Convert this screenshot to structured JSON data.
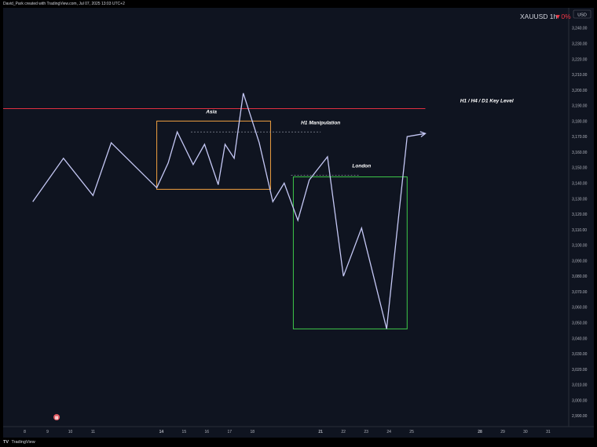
{
  "header": {
    "attribution": "David_Park created with TradingView.com, Jul 07, 2025 13:03 UTC+2"
  },
  "footer": {
    "logo_glyph": "TV",
    "brand": "TradingView"
  },
  "chart_data": {
    "type": "line",
    "symbol": "XAUUSD",
    "timeframe": "1h",
    "change": "▼0%",
    "currency": "USD",
    "x_ticks": [
      {
        "x": 8,
        "label": "8",
        "bold": false
      },
      {
        "x": 9,
        "label": "9",
        "bold": false
      },
      {
        "x": 10,
        "label": "10",
        "bold": false
      },
      {
        "x": 11,
        "label": "11",
        "bold": false
      },
      {
        "x": 14,
        "label": "14",
        "bold": true
      },
      {
        "x": 15,
        "label": "15",
        "bold": false
      },
      {
        "x": 16,
        "label": "16",
        "bold": false
      },
      {
        "x": 17,
        "label": "17",
        "bold": false
      },
      {
        "x": 18,
        "label": "18",
        "bold": false
      },
      {
        "x": 21,
        "label": "21",
        "bold": true
      },
      {
        "x": 22,
        "label": "22",
        "bold": false
      },
      {
        "x": 23,
        "label": "23",
        "bold": false
      },
      {
        "x": 24,
        "label": "24",
        "bold": false
      },
      {
        "x": 25,
        "label": "25",
        "bold": false
      },
      {
        "x": 28,
        "label": "28",
        "bold": true
      },
      {
        "x": 29,
        "label": "29",
        "bold": false
      },
      {
        "x": 30,
        "label": "30",
        "bold": false
      },
      {
        "x": 31,
        "label": "31",
        "bold": false
      }
    ],
    "y_ticks": [
      2990,
      3000,
      3010,
      3020,
      3030,
      3040,
      3050,
      3060,
      3070,
      3080,
      3090,
      3100,
      3110,
      3120,
      3130,
      3140,
      3150,
      3160,
      3170,
      3180,
      3190,
      3200,
      3210,
      3220,
      3230,
      3240
    ],
    "y_tick_labels": [
      "2,990.00",
      "3,000.00",
      "3,010.00",
      "3,020.00",
      "3,030.00",
      "3,040.00",
      "3,050.00",
      "3,060.00",
      "3,070.00",
      "3,080.00",
      "3,090.00",
      "3,100.00",
      "3,110.00",
      "3,120.00",
      "3,130.00",
      "3,140.00",
      "3,150.00",
      "3,160.00",
      "3,170.00",
      "3,180.00",
      "3,190.00",
      "3,200.00",
      "3,210.00",
      "3,220.00",
      "3,230.00",
      "3,240.00"
    ],
    "ylim": [
      2983,
      3253
    ],
    "xlim": [
      7.05,
      31.9
    ],
    "series": [
      {
        "color": "#c5c8f5",
        "x": [
          8.35,
          9.7,
          11.0,
          11.8,
          13.8,
          14.3,
          14.7,
          15.0,
          15.4,
          15.9,
          16.5,
          16.8,
          17.2,
          17.6,
          18.3,
          18.9,
          19.4,
          20.0,
          20.5,
          21.3,
          22.0,
          22.8,
          23.9,
          24.8,
          25.6
        ],
        "y": [
          3128,
          3156,
          3132,
          3166,
          3137,
          3153,
          3173,
          3164,
          3152,
          3165,
          3139,
          3165,
          3156,
          3198,
          3166,
          3128,
          3140,
          3116,
          3142,
          3157,
          3080,
          3111,
          3046,
          3170,
          3172
        ],
        "arrow_end": true
      }
    ],
    "annotations": [
      {
        "type": "hline",
        "y": 3188,
        "x0": 7.05,
        "x1": 25.6,
        "color": "#e03040",
        "label": "H1 / H4 / D1 Key  Level",
        "label_x": 28.3,
        "label_y": 3192
      },
      {
        "type": "rect",
        "x0": 13.8,
        "x1": 18.8,
        "y0": 3136,
        "y1": 3180,
        "color": "#f0a040",
        "label": "Asia",
        "label_x": 16.2,
        "label_y": 3185
      },
      {
        "type": "dashed_line",
        "x0": 15.3,
        "x1": 21.0,
        "y": 3173,
        "color": "#8a8f9c",
        "label": "H1  Manipulation",
        "label_x": 21.0,
        "label_y": 3178
      },
      {
        "type": "rect",
        "x0": 19.8,
        "x1": 24.8,
        "y0": 3046,
        "y1": 3144,
        "color": "#3ec94a",
        "label": "London",
        "label_x": 22.8,
        "label_y": 3150
      },
      {
        "type": "dashed_line",
        "x0": 19.7,
        "x1": 22.7,
        "y": 3145,
        "color": "#8a8f9c"
      }
    ],
    "grid": false,
    "event_marker": {
      "x": 9.4,
      "glyph": "▦"
    }
  }
}
